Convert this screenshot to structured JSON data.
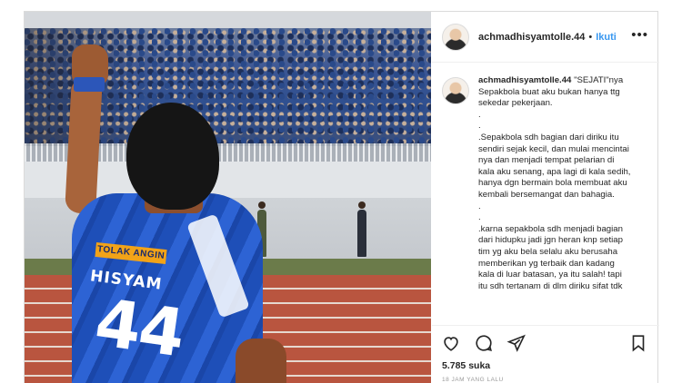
{
  "header": {
    "username": "achmadhisyamtolle.44",
    "separator": "•",
    "follow_label": "Ikuti",
    "more_icon": "more-options-icon"
  },
  "photo": {
    "sponsor": "TOLAK ANGIN",
    "player_name": "HISYAM",
    "player_number": "44"
  },
  "caption": {
    "username": "achmadhisyamtolle.44",
    "first_line_rest": "\"SEJATI\"nya",
    "lines": [
      "Sepakbola buat aku bukan hanya ttg",
      "sekedar pekerjaan.",
      ".",
      ".",
      ".Sepakbola sdh bagian dari diriku itu",
      "sendiri sejak kecil, dan mulai mencintai",
      "nya dan menjadi tempat pelarian di",
      "kala aku senang, apa lagi di kala sedih,",
      "hanya dgn bermain bola membuat aku",
      "kembali bersemangat dan bahagia.",
      ".",
      ".",
      ".karna sepakbola sdh menjadi bagian",
      "dari hidupku jadi jgn heran knp setiap",
      "tim yg aku bela selalu aku berusaha",
      "memberikan yg terbaik dan kadang",
      "kala di luar batasan, ya itu salah! tapi",
      "itu sdh tertanam di dlm diriku sifat tdk"
    ]
  },
  "actions": {
    "icons": [
      "heart-icon",
      "comment-icon",
      "share-icon",
      "bookmark-icon"
    ],
    "likes": "5.785 suka",
    "timestamp": "18 JAM YANG LALU"
  },
  "colors": {
    "link_blue": "#3897f0",
    "text": "#262626",
    "border": "#dbdbdb",
    "muted": "#999999"
  }
}
